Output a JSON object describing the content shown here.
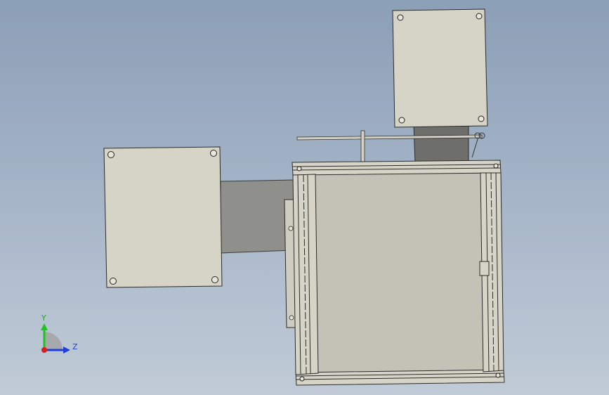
{
  "triad": {
    "y_label": "Y",
    "z_label": "Z"
  },
  "colors": {
    "background_top": "#8b9fb7",
    "background_bottom": "#c1cbd7",
    "panel": "#d6d4c7",
    "panel_shadow": "#bfbdb1",
    "duct": "#8f8f8b",
    "duct_dark": "#6e6e6a",
    "frame": "#c9c8bd",
    "outline": "#2b2b2b",
    "axis_y": "#1fc51f",
    "axis_z": "#1f3fd8",
    "origin": "#d81f1f"
  }
}
